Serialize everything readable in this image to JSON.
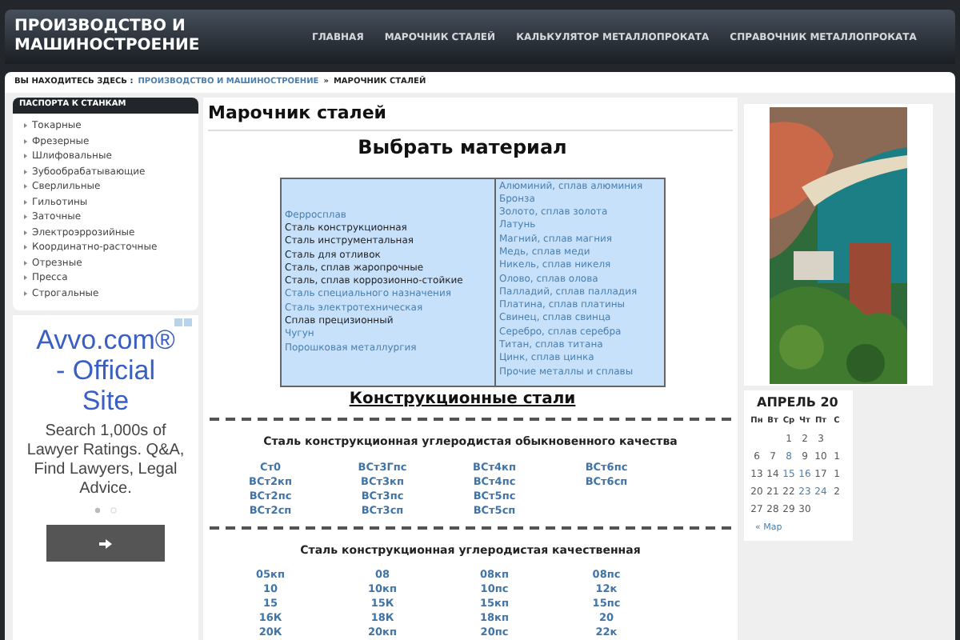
{
  "site_title": "ПРОИЗВОДСТВО И МАШИНОСТРОЕНИЕ",
  "nav": [
    {
      "label": "ГЛАВНАЯ"
    },
    {
      "label": "МАРОЧНИК СТАЛЕЙ"
    },
    {
      "label": "КАЛЬКУЛЯТОР МЕТАЛЛОПРОКАТА"
    },
    {
      "label": "СПРАВОЧНИК МЕТАЛЛОПРОКАТА"
    }
  ],
  "breadcrumb": {
    "prefix": "ВЫ НАХОДИТЕСЬ ЗДЕСЬ :",
    "items": [
      {
        "label": "ПРОИЗВОДСТВО И МАШИНОСТРОЕНИЕ",
        "link": true
      },
      {
        "label": "МАРОЧНИК СТАЛЕЙ",
        "link": false
      }
    ],
    "separator": "»"
  },
  "sidebar": {
    "title": "ПАСПОРТА К СТАНКАМ",
    "items": [
      "Токарные",
      "Фрезерные",
      "Шлифовальные",
      "Зубообрабатывающие",
      "Сверлильные",
      "Гильотины",
      "Заточные",
      "Электроэррозийные",
      "Координатно-расточные",
      "Отрезные",
      "Пресса",
      "Строгальные"
    ]
  },
  "ad": {
    "headline": "Avvo.com® - Official Site",
    "body": "Search 1,000s of Lawyer Ratings. Q&A, Find Lawyers, Legal Advice."
  },
  "page_title": "Марочник сталей",
  "choose_title": "Выбрать материал",
  "materials": {
    "left": [
      {
        "label": "Ферросплав",
        "color": "#4a7fae"
      },
      {
        "label": "Сталь конструкционная",
        "color": "#222222"
      },
      {
        "label": "Сталь инструментальная",
        "color": "#222222"
      },
      {
        "label": "Сталь для отливок",
        "color": "#222222"
      },
      {
        "label": "Сталь, сплав жаропрочные",
        "color": "#222222"
      },
      {
        "label": "Сталь, сплав коррозионно-стойкие",
        "color": "#222222"
      },
      {
        "label": "Сталь специального назначения",
        "color": "#4a7fae"
      },
      {
        "label": "Сталь электротехническая",
        "color": "#4a7fae"
      },
      {
        "label": "Сплав прецизионный",
        "color": "#222222"
      },
      {
        "label": "Чугун",
        "color": "#4a7fae"
      },
      {
        "label": "Порошковая металлургия",
        "color": "#4a7fae"
      }
    ],
    "right": [
      "Алюминий, сплав алюминия",
      "Бронза",
      "Золото, сплав золота",
      "Латунь",
      "Магний, сплав магния",
      "Медь, сплав меди",
      "Никель, сплав никеля",
      "Олово, сплав олова",
      "Палладий, сплав палладия",
      "Платина, сплав платины",
      "Свинец, сплав свинца",
      "Серебро, сплав серебра",
      "Титан, сплав титана",
      "Цинк, сплав цинка",
      "Прочие металлы и сплавы"
    ]
  },
  "section_title": "Конструкционные стали",
  "groups": [
    {
      "title": "Сталь конструкционная углеродистая обыкновенного качества",
      "columns": [
        [
          "Ст0",
          "ВСт2кп",
          "ВСт2пс",
          "ВСт2сп"
        ],
        [
          "ВСт3Гпс",
          "ВСт3кп",
          "ВСт3пс",
          "ВСт3сп"
        ],
        [
          "ВСт4кп",
          "ВСт4пс",
          "ВСт5пс",
          "ВСт5сп"
        ],
        [
          "ВСт6пс",
          "ВСт6сп"
        ]
      ]
    },
    {
      "title": "Сталь конструкционная углеродистая качественная",
      "columns": [
        [
          "05кп",
          "10",
          "15",
          "16К",
          "20К"
        ],
        [
          "08",
          "10кп",
          "15К",
          "18К",
          "20кп"
        ],
        [
          "08кп",
          "10пс",
          "15кп",
          "18кп",
          "20пс"
        ],
        [
          "08пс",
          "12к",
          "15пс",
          "20",
          "22к"
        ]
      ]
    }
  ],
  "calendar": {
    "title": "АПРЕЛЬ 20",
    "weekdays": [
      "Пн",
      "Вт",
      "Ср",
      "Чт",
      "Пт",
      "С"
    ],
    "weeks": [
      [
        {
          "day": "1",
          "linked": false
        },
        {
          "day": "2",
          "linked": false
        },
        {
          "day": "3",
          "linked": false
        }
      ],
      [
        {
          "day": "6",
          "linked": false
        },
        {
          "day": "7",
          "linked": false
        },
        {
          "day": "8",
          "linked": true
        },
        {
          "day": "9",
          "linked": false
        },
        {
          "day": "10",
          "linked": false
        },
        {
          "day": "1",
          "linked": false
        }
      ],
      [
        {
          "day": "13",
          "linked": false
        },
        {
          "day": "14",
          "linked": false
        },
        {
          "day": "15",
          "linked": true
        },
        {
          "day": "16",
          "linked": true
        },
        {
          "day": "17",
          "linked": false
        },
        {
          "day": "1",
          "linked": false
        }
      ],
      [
        {
          "day": "20",
          "linked": false
        },
        {
          "day": "21",
          "linked": false
        },
        {
          "day": "22",
          "linked": false
        },
        {
          "day": "23",
          "linked": true
        },
        {
          "day": "24",
          "linked": true
        },
        {
          "day": "2",
          "linked": false
        }
      ],
      [
        {
          "day": "27",
          "linked": false
        },
        {
          "day": "28",
          "linked": false
        },
        {
          "day": "29",
          "linked": false
        },
        {
          "day": "30",
          "linked": false
        }
      ]
    ],
    "prev": "« Мар"
  }
}
